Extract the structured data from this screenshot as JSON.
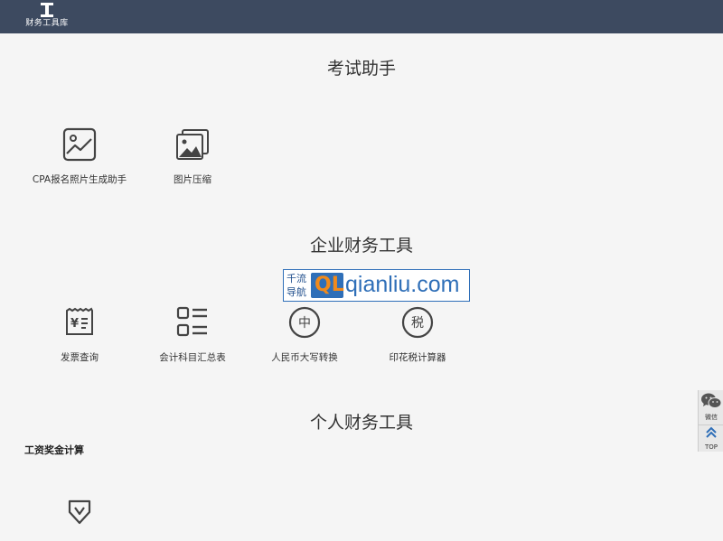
{
  "header": {
    "logo_text": "财务工具库"
  },
  "sections": [
    {
      "title": "考试助手",
      "tools": [
        {
          "label": "CPA报名照片生成助手",
          "icon": "photo-frame-icon"
        },
        {
          "label": "图片压缩",
          "icon": "image-stack-icon"
        }
      ]
    },
    {
      "title": "企业财务工具",
      "tools": [
        {
          "label": "发票查询",
          "icon": "invoice-icon"
        },
        {
          "label": "会计科目汇总表",
          "icon": "list-grid-icon"
        },
        {
          "label": "人民币大写转换",
          "icon": "zhong-circle-icon"
        },
        {
          "label": "印花税计算器",
          "icon": "tax-circle-icon"
        }
      ]
    },
    {
      "title": "个人财务工具",
      "subtitle": "工资奖金计算",
      "tools": [
        {
          "icon": "shield-down-icon"
        }
      ]
    }
  ],
  "icon_glyphs": {
    "invoice": "¥",
    "zhong": "中",
    "tax": "税"
  },
  "watermark": {
    "cn": "千流导航",
    "ql": "QL",
    "url": "qianliu.com"
  },
  "side": {
    "wechat_label": "微信",
    "top_label": "TOP"
  },
  "colors": {
    "header_bg": "#3d4a60",
    "page_bg": "#f5f5f5",
    "watermark_blue": "#2f6fb8",
    "watermark_orange": "#f08a1c"
  }
}
